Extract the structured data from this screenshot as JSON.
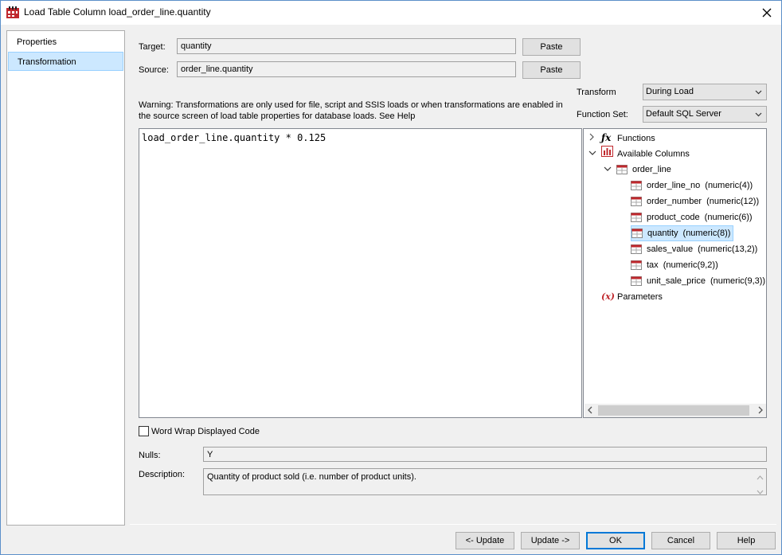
{
  "window": {
    "title": "Load Table Column load_order_line.quantity"
  },
  "nav": {
    "items": [
      {
        "label": "Properties"
      },
      {
        "label": "Transformation"
      }
    ]
  },
  "target": {
    "label": "Target:",
    "value": "quantity",
    "paste_label": "Paste"
  },
  "source": {
    "label": "Source:",
    "value": "order_line.quantity",
    "paste_label": "Paste"
  },
  "transform": {
    "label": "Transform",
    "value": "During Load"
  },
  "function_set": {
    "label": "Function Set:",
    "value": "Default SQL Server"
  },
  "warning": "Warning: Transformations are only used for file, script and SSIS loads or when transformations are enabled in the source screen of load table properties for database loads. See Help",
  "editor": {
    "code": "load_order_line.quantity * 0.125"
  },
  "tree": {
    "functions": "Functions",
    "available_columns": "Available Columns",
    "table": "order_line",
    "columns": [
      {
        "name": "order_line_no",
        "type": "(numeric(4))"
      },
      {
        "name": "order_number",
        "type": "(numeric(12))"
      },
      {
        "name": "product_code",
        "type": "(numeric(6))"
      },
      {
        "name": "quantity",
        "type": "(numeric(8))"
      },
      {
        "name": "sales_value",
        "type": "(numeric(13,2))"
      },
      {
        "name": "tax",
        "type": "(numeric(9,2))"
      },
      {
        "name": "unit_sale_price",
        "type": "(numeric(9,3))"
      }
    ],
    "parameters": "Parameters",
    "selected": "quantity"
  },
  "word_wrap": {
    "label": "Word Wrap Displayed Code",
    "checked": false
  },
  "nulls": {
    "label": "Nulls:",
    "value": "Y"
  },
  "description": {
    "label": "Description:",
    "value": "Quantity of product sold (i.e. number of product units)."
  },
  "buttons": {
    "update_prev": "<- Update",
    "update_next": "Update ->",
    "ok": "OK",
    "cancel": "Cancel",
    "help": "Help"
  },
  "colors": {
    "selection_bg": "#cce8ff",
    "window_bg": "#f0f0f0",
    "accent": "#0078d7",
    "icon_red": "#c0282d"
  }
}
